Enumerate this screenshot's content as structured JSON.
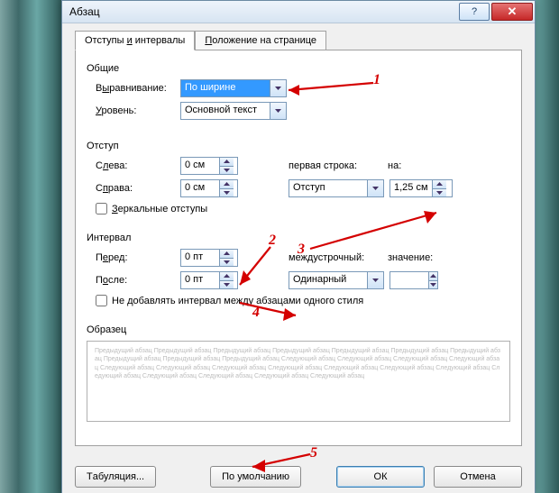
{
  "window": {
    "title": "Абзац"
  },
  "tabs": {
    "active": "Отступы и интервалы",
    "other": "Положение на странице",
    "active_ul_char": "и",
    "other_ul_char": "П"
  },
  "sections": {
    "general": "Общие",
    "indent": "Отступ",
    "spacing": "Интервал",
    "preview": "Образец"
  },
  "general": {
    "alignment_label_pre": "В",
    "alignment_label_ul": "ы",
    "alignment_label_post": "равнивание:",
    "alignment_value": "По ширине",
    "level_label_pre": "",
    "level_label_ul": "У",
    "level_label_post": "ровень:",
    "level_value": "Основной текст"
  },
  "indent": {
    "left_label_pre": "С",
    "left_label_ul": "л",
    "left_label_post": "ева:",
    "left_value": "0 см",
    "right_label_pre": "С",
    "right_label_ul": "п",
    "right_label_post": "рава:",
    "right_value": "0 см",
    "first_line_label_pre": "перва",
    "first_line_label_ul": "я",
    "first_line_label_post": " строка:",
    "first_line_value": "Отступ",
    "by_label_pre": "",
    "by_label_ul": "н",
    "by_label_post": "а:",
    "by_value": "1,25 см",
    "mirror_label_pre": "",
    "mirror_label_ul": "З",
    "mirror_label_post": "еркальные отступы"
  },
  "spacing": {
    "before_label_pre": "П",
    "before_label_ul": "е",
    "before_label_post": "ред:",
    "before_value": "0 пт",
    "after_label_pre": "П",
    "after_label_ul": "о",
    "after_label_post": "сле:",
    "after_value": "0 пт",
    "line_label_pre": "",
    "line_label_ul": "м",
    "line_label_post": "еждустрочный:",
    "line_value": "Одинарный",
    "at_label_pre": "",
    "at_label_ul": "з",
    "at_label_post": "начение:",
    "at_value": "",
    "no_space_label": "Не добавлять интервал между абзацами одного стиля"
  },
  "preview_text": "Предыдущий абзац Предыдущий абзац Предыдущий абзац Предыдущий абзац Предыдущий абзац Предыдущий абзац Предыдущий абзац Предыдущий абзац Предыдущий абзац Предыдущий абзац\n\nСледующий абзац Следующий абзац Следующий абзац Следующий абзац Следующий абзац Следующий абзац Следующий абзац Следующий абзац Следующий абзац Следующий абзац Следующий абзац Следующий абзац Следующий абзац Следующий абзац Следующий абзац Следующий абзац",
  "buttons": {
    "tabs_pre": "",
    "tabs_ul": "Т",
    "tabs_post": "абуляция...",
    "default_pre": "По умо",
    "default_ul": "л",
    "default_post": "чанию",
    "ok": "ОК",
    "cancel": "Отмена"
  },
  "annotations": {
    "n1": "1",
    "n2": "2",
    "n3": "3",
    "n4": "4",
    "n5": "5"
  }
}
